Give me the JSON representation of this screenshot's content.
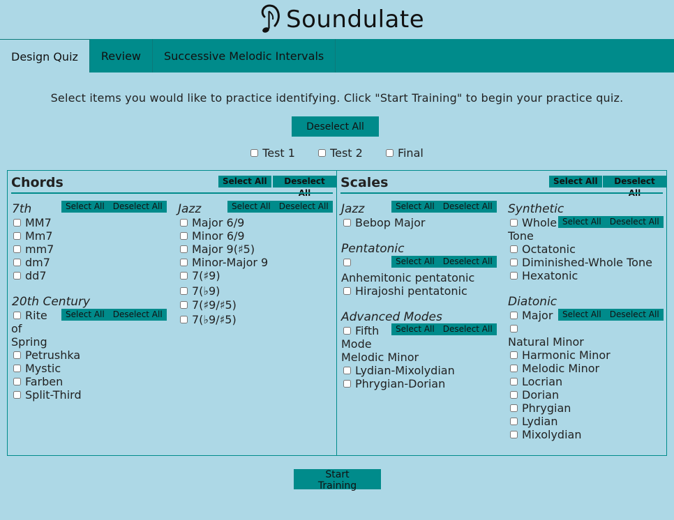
{
  "app": {
    "title": "Soundulate",
    "logo_icon": "ear-note-icon"
  },
  "tabs": [
    "Design Quiz",
    "Review",
    "Successive Melodic Intervals"
  ],
  "intro": "Select items you would like to practice identifying. Click \"Start Training\" to begin your practice quiz.",
  "deselect_all_label": "Deselect All",
  "select_all_label": "Select All",
  "tests": [
    "Test 1",
    "Test 2",
    "Final"
  ],
  "chords": {
    "title": "Chords",
    "seventh": {
      "title": "7th",
      "items": [
        "MM7",
        "Mm7",
        "mm7",
        "dm7",
        "dd7"
      ]
    },
    "jazz": {
      "title": "Jazz",
      "items": [
        "Major 6/9",
        "Minor 6/9",
        "Major 9(♯5)",
        "Minor-Major 9",
        "7(♯9)",
        "7(♭9)",
        "7(♯9/♯5)",
        "7(♭9/♯5)"
      ]
    },
    "twentieth": {
      "title": "20th Century",
      "items": [
        "Rite",
        "of",
        "Spring",
        "Petrushka",
        "Mystic",
        "Farben",
        "Split-Third"
      ]
    }
  },
  "scales": {
    "title": "Scales",
    "jazz": {
      "title": "Jazz",
      "items": [
        "Bebop Major"
      ]
    },
    "pentatonic": {
      "title": "Pentatonic",
      "items": [
        "Anhemitonic pentatonic",
        "Hirajoshi pentatonic"
      ]
    },
    "advanced": {
      "title": "Advanced Modes",
      "items": [
        "Fifth",
        "Mode",
        "Melodic Minor",
        "Lydian-Mixolydian",
        "Phrygian-Dorian"
      ]
    },
    "synthetic": {
      "title": "Synthetic",
      "items": [
        "Whole",
        "Tone",
        "Octatonic",
        "Diminished-Whole Tone",
        "Hexatonic"
      ]
    },
    "diatonic": {
      "title": "Diatonic",
      "items": [
        "Major",
        "Natural Minor",
        "Harmonic Minor",
        "Melodic Minor",
        "Locrian",
        "Dorian",
        "Phrygian",
        "Lydian",
        "Mixolydian"
      ]
    }
  },
  "start_label": "Start Training",
  "colors": {
    "background": "#add8e6",
    "accent": "#008b8b"
  }
}
